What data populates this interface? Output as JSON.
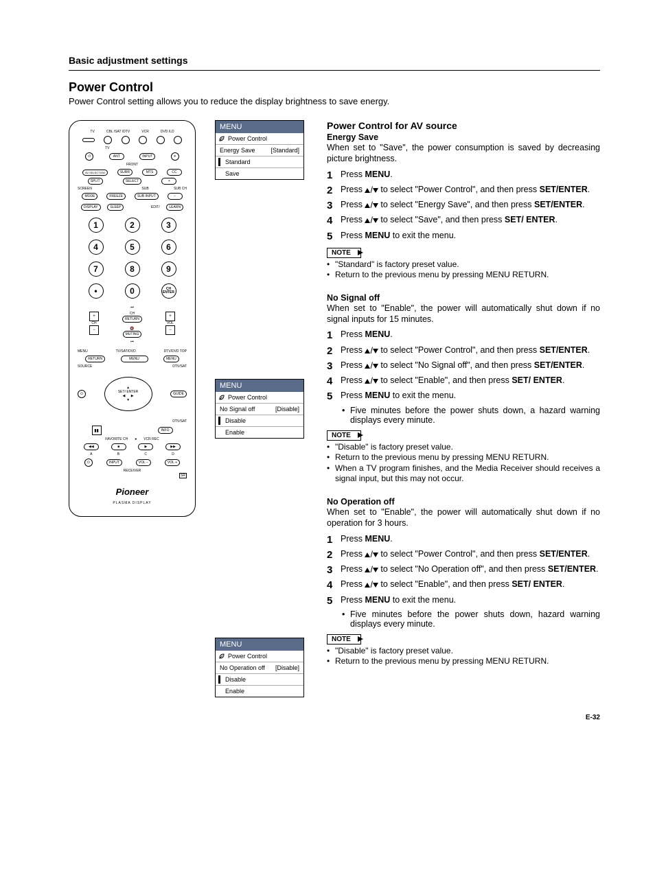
{
  "header": {
    "section": "Basic adjustment settings"
  },
  "title": "Power Control",
  "intro": "Power Control setting allows you to reduce the display brightness to save energy.",
  "remote": {
    "top_labels": [
      "TV",
      "CBL /SAT /DTV",
      "VCR",
      "DVD /LD"
    ],
    "row2": [
      "ANT",
      "INPUT"
    ],
    "front": "FRONT",
    "row3": [
      "AV SELECTION",
      "SURR",
      "MTS",
      "CC"
    ],
    "row4": [
      "SPLIT",
      "SELECT",
      "+"
    ],
    "row5l": "SCREEN",
    "row5": [
      "FREEZE",
      "SUB INPUT",
      "SUB CH"
    ],
    "row5b": [
      "MODE",
      "",
      "",
      ""
    ],
    "row5r": "−",
    "row6": [
      "DISPLAY",
      "SLEEP",
      "",
      "EDIT/",
      "LEARN"
    ],
    "nums": [
      [
        "1",
        "2",
        "3"
      ],
      [
        "4",
        "5",
        "6"
      ],
      [
        "7",
        "8",
        "9"
      ],
      [
        "•",
        "0",
        "CH ENTER"
      ]
    ],
    "mid_labels": {
      "ch": "CH",
      "ret": "RETURN",
      "mut": "MUTING",
      "vol": "VOL",
      "ch2": "CH"
    },
    "menus": {
      "l": "MENU",
      "c": "TV/SAT/DVD",
      "r": "DTV/DVD TOP",
      "rl": "RETURN",
      "cm": "MENU",
      "rr": "MENU"
    },
    "src": "SOURCE",
    "dtvsat": "DTV/SAT",
    "guide": "GUIDE",
    "setenter": "SET/ ENTER",
    "info": "INFO",
    "fav": "FAVORITE CH",
    "vcrrec": "VCR REC",
    "abcd": [
      "A",
      "B",
      "C",
      "D"
    ],
    "bot": [
      "INPUT",
      "VOL −",
      "VOL +"
    ],
    "receiver": "RECEIVER",
    "brand": "Pioneer",
    "brand_sub": "PLASMA DISPLAY"
  },
  "menus": [
    {
      "header": "MENU",
      "sub": "Power Control",
      "data_label": "Energy Save",
      "data_value": "[Standard]",
      "opts": [
        "Standard",
        "Save"
      ],
      "sel": 0
    },
    {
      "header": "MENU",
      "sub": "Power Control",
      "data_label": "No Signal off",
      "data_value": "[Disable]",
      "opts": [
        "Disable",
        "Enable"
      ],
      "sel": 0
    },
    {
      "header": "MENU",
      "sub": "Power Control",
      "data_label": "No Operation off",
      "data_value": "[Disable]",
      "opts": [
        "Disable",
        "Enable"
      ],
      "sel": 0
    }
  ],
  "sections": {
    "av": {
      "title": "Power Control for AV source",
      "energy": {
        "sub": "Energy Save",
        "desc": "When set to \"Save\",  the power consumption is saved by decreasing picture brightness.",
        "steps": [
          {
            "pre": "Press ",
            "b1": "MENU",
            "post": "."
          },
          {
            "pre": "Press ",
            "arrows": true,
            "mid": " to select \"Power Control\", and then press ",
            "b1": "SET/ENTER",
            "post": "."
          },
          {
            "pre": "Press ",
            "arrows": true,
            "mid": " to select \"Energy Save\", and then press ",
            "b1": "SET/ENTER",
            "post": "."
          },
          {
            "pre": "Press ",
            "arrows": true,
            "mid": " to select \"Save\", and then press ",
            "b1": "SET/ ENTER",
            "post": "."
          },
          {
            "pre": "Press ",
            "b1": "MENU",
            "post": " to exit the menu."
          }
        ],
        "note_label": "NOTE",
        "notes": [
          "\"Standard\" is factory preset value.",
          {
            "pre": "Return to the previous menu by pressing ",
            "b": "MENU RETURN",
            "post": "."
          }
        ]
      },
      "nosig": {
        "sub": "No Signal off",
        "desc": "When set to \"Enable\", the power will automatically shut down if no signal inputs for 15 minutes.",
        "steps": [
          {
            "pre": "Press ",
            "b1": "MENU",
            "post": "."
          },
          {
            "pre": "Press ",
            "arrows": true,
            "mid": " to select \"Power Control\", and then press ",
            "b1": "SET/ENTER",
            "post": "."
          },
          {
            "pre": "Press ",
            "arrows": true,
            "mid": " to select \"No Signal off\", and then press ",
            "b1": "SET/ENTER",
            "post": "."
          },
          {
            "pre": "Press ",
            "arrows": true,
            "mid": " to select \"Enable\", and then press ",
            "b1": "SET/ ENTER",
            "post": "."
          },
          {
            "pre": "Press ",
            "b1": "MENU",
            "post": " to exit the menu."
          }
        ],
        "sub_bullet": "Five minutes before the power shuts down, a hazard warning displays every minute.",
        "note_label": "NOTE",
        "notes": [
          "\"Disable\" is factory preset value.",
          {
            "pre": "Return to the previous menu by pressing ",
            "b": "MENU RETURN",
            "post": "."
          },
          "When a TV program finishes, and the Media Receiver should receives a signal input, but this may not occur."
        ]
      },
      "noop": {
        "sub": "No Operation off",
        "desc": "When set to \"Enable\", the power will automatically shut down if no operation for 3 hours.",
        "steps": [
          {
            "pre": "Press ",
            "b1": "MENU",
            "post": "."
          },
          {
            "pre": "Press ",
            "arrows": true,
            "mid": " to select \"Power Control\", and then press ",
            "b1": "SET/ENTER",
            "post": "."
          },
          {
            "pre": "Press ",
            "arrows": true,
            "mid": " to select \"No Operation off\", and then press ",
            "b1": "SET/ENTER",
            "post": "."
          },
          {
            "pre": "Press ",
            "arrows": true,
            "mid": " to select \"Enable\", and then press ",
            "b1": "SET/ ENTER",
            "post": "."
          },
          {
            "pre": "Press ",
            "b1": "MENU",
            "post": " to exit the menu."
          }
        ],
        "sub_bullet": "Five minutes before the power shuts down, hazard warning displays every minute.",
        "note_label": "NOTE",
        "notes": [
          "\"Disable\" is factory preset value.",
          {
            "pre": "Return to the previous menu by pressing ",
            "b": "MENU RETURN",
            "post": "."
          }
        ]
      }
    }
  },
  "page": "E-32"
}
